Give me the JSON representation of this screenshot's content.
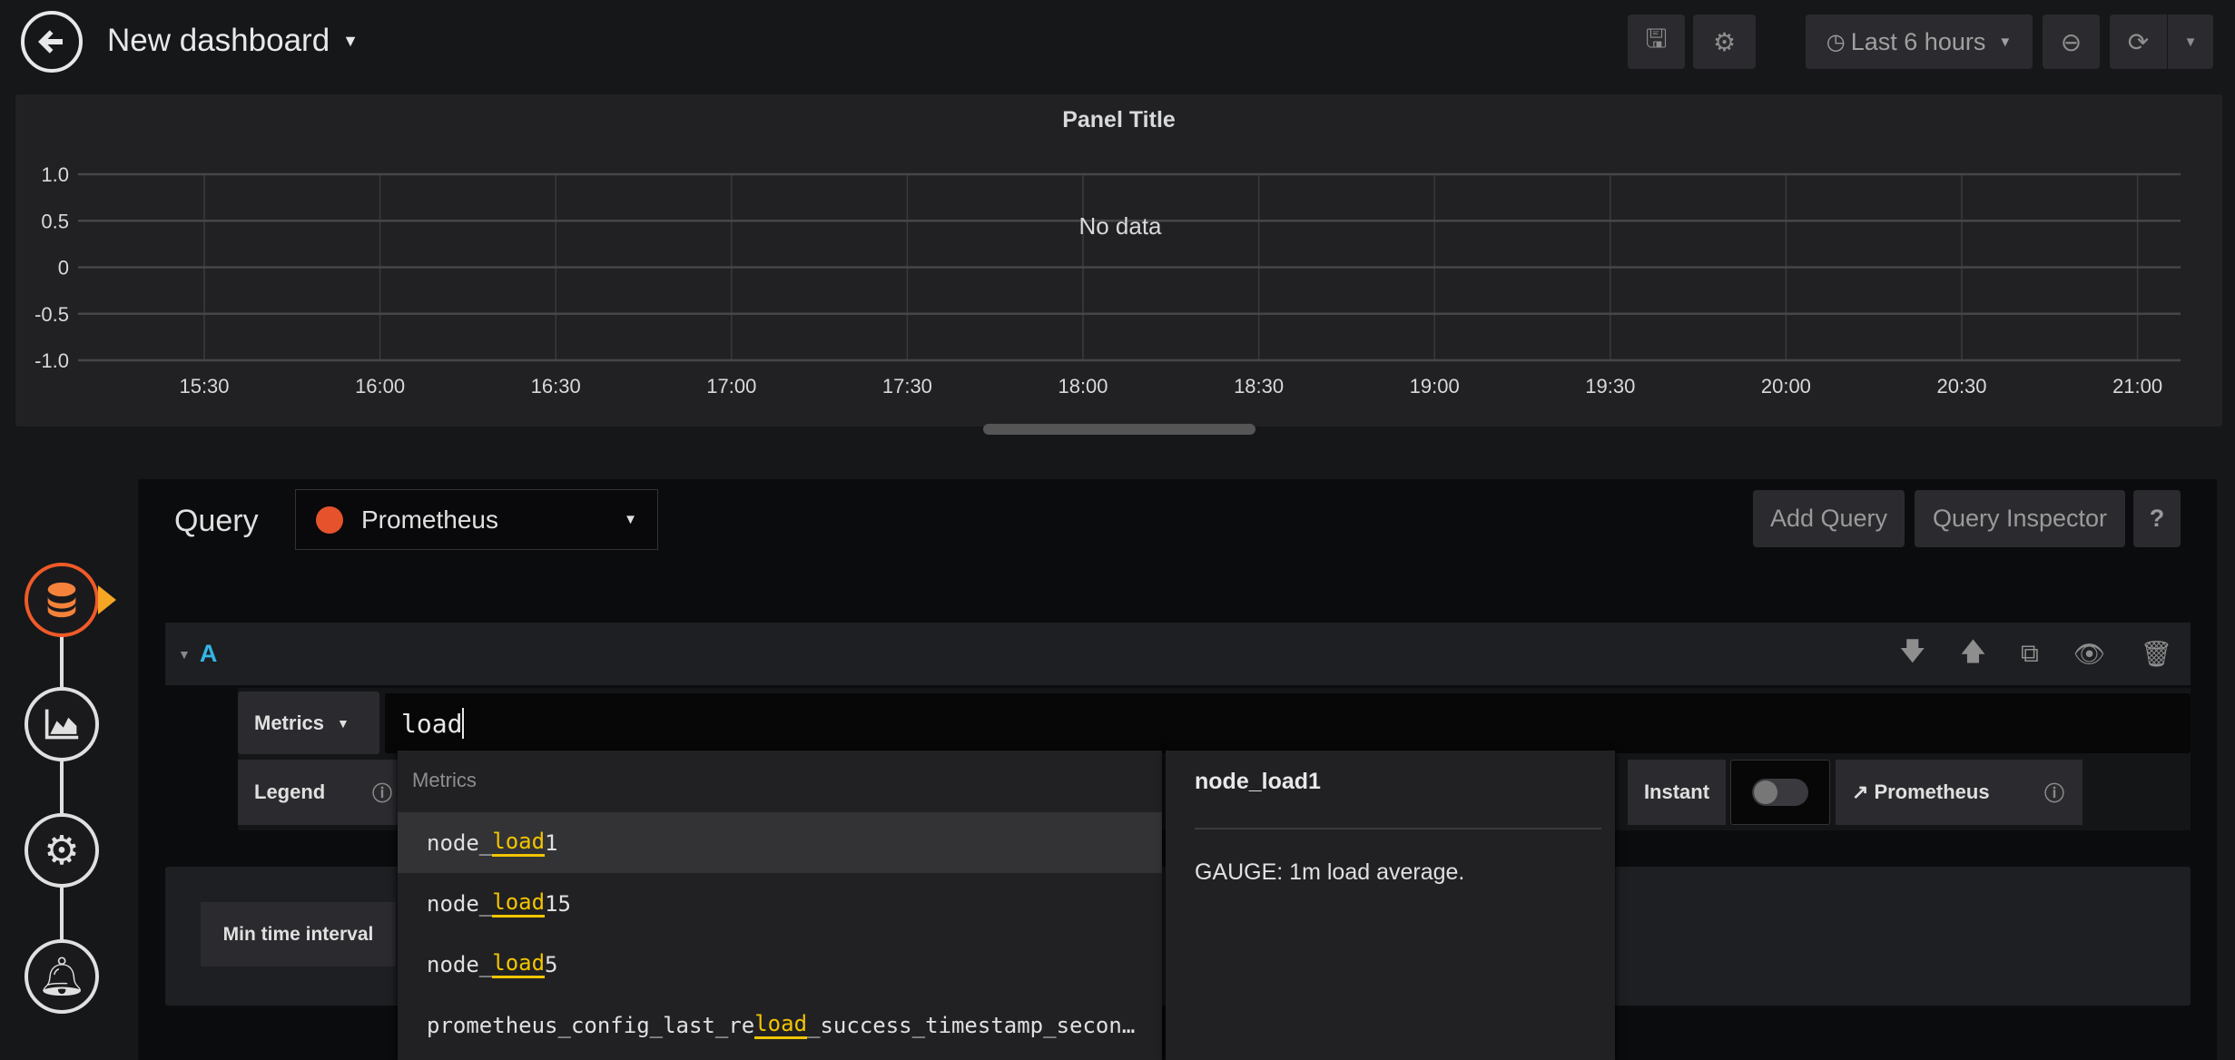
{
  "header": {
    "title": "New dashboard",
    "time_range": "Last 6 hours"
  },
  "panel": {
    "title": "Panel Title",
    "no_data": "No data"
  },
  "chart_data": {
    "type": "line",
    "title": "Panel Title",
    "annotation": "No data",
    "series": [],
    "y_ticks": [
      "1.0",
      "0.5",
      "0",
      "-0.5",
      "-1.0"
    ],
    "ylim": [
      -1,
      1
    ],
    "x_ticks": [
      "15:30",
      "16:00",
      "16:30",
      "17:00",
      "17:30",
      "18:00",
      "18:30",
      "19:00",
      "19:30",
      "20:00",
      "20:30",
      "21:00"
    ],
    "grid": true
  },
  "query": {
    "label": "Query",
    "datasource": "Prometheus",
    "add_query": "Add Query",
    "query_inspector": "Query Inspector",
    "help": "?"
  },
  "row": {
    "ref_id": "A"
  },
  "metrics": {
    "button": "Metrics",
    "input_value": "load"
  },
  "legend": {
    "label": "Legend"
  },
  "instant": {
    "label": "Instant",
    "enabled": false
  },
  "format_link": "Prometheus",
  "options": {
    "min_interval": "Min time interval"
  },
  "suggest": {
    "header": "Metrics",
    "items": [
      {
        "pre": "node_",
        "match": "load",
        "post": "1"
      },
      {
        "pre": "node_",
        "match": "load",
        "post": "15"
      },
      {
        "pre": "node_",
        "match": "load",
        "post": "5"
      },
      {
        "pre": "prometheus_config_last_re",
        "match": "load",
        "post": "_success_timestamp_secon…"
      }
    ]
  },
  "doc": {
    "title": "node_load1",
    "text": "GAUGE: 1m load average."
  },
  "colors": {
    "accent": "#33b5e5",
    "highlight": "#f2c500",
    "nav_active": "#f05a28"
  }
}
